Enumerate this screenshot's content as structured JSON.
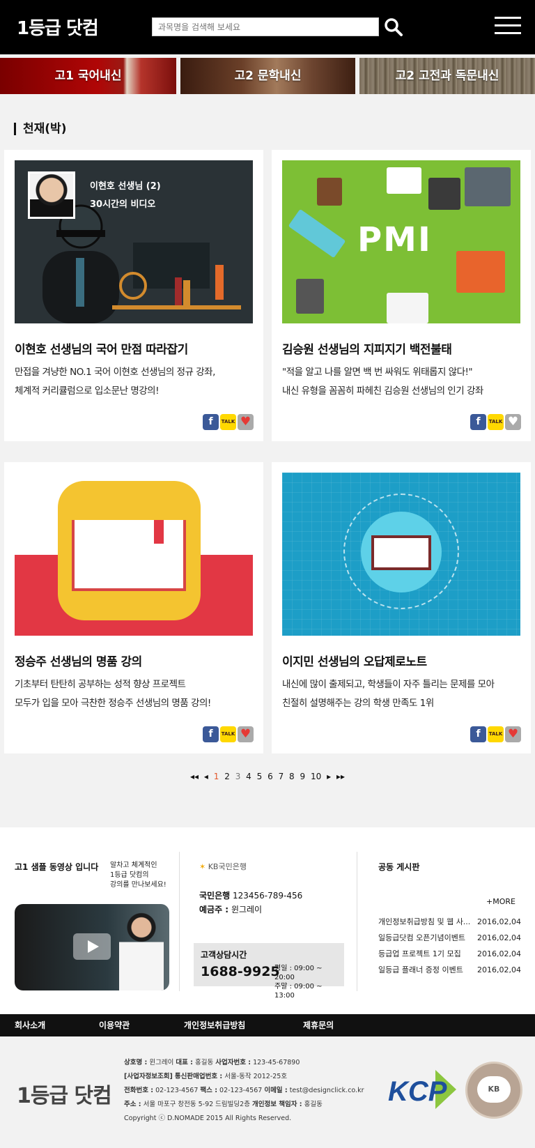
{
  "header": {
    "logo": "1등급 닷컴",
    "search_placeholder": "과목명을 검색해 보세요"
  },
  "banners": [
    {
      "label": "고1 국어내신"
    },
    {
      "label": "고2 문학내신"
    },
    {
      "label": "고2 고전과 독문내신"
    }
  ],
  "section": {
    "title": "천재(박)"
  },
  "cards": [
    {
      "title": "이현호 선생님의 국어 만점 따라잡기",
      "desc_line1": "만접을 겨냥한 NO.1 국어 이현호 선생님의 정규 강좌,",
      "desc_line2": "체계적 커리큘럼으로 입소문난 명강의!",
      "thumb_name": "이현호 선생님 (2)",
      "thumb_video": "30시간의 비디오"
    },
    {
      "title": "김승원 선생님의 지피지기 백전불태",
      "desc_line1": "\"적을 알고 나를 알면 백 번 싸워도 위태롭지 않다!\"",
      "desc_line2": "내신 유형을 꼼꼼히 파헤친 김승원 선생님의 인기 강좌",
      "thumb_text": "PMI"
    },
    {
      "title": "정승주 선생님의 명품 강의",
      "desc_line1": "기초부터 탄탄히 공부하는 성적 향상 프로젝트",
      "desc_line2": "모두가 입을 모아 극찬한 정승주 선생님의 명품 강의!"
    },
    {
      "title": "이지민 선생님의 오답제로노트",
      "desc_line1": "내신에 많이 출제되고, 학생들이 자주 틀리는 문제를 모아",
      "desc_line2": "친절히 설명해주는 강의 학생 만족도 1위"
    }
  ],
  "share": {
    "facebook": "f",
    "kakaotalk": "TALK",
    "like": "♥"
  },
  "pagination": {
    "first": "◂◂",
    "prev": "◂",
    "next": "▸",
    "last": "▸▸",
    "pages": [
      "1",
      "2",
      "3",
      "4",
      "5",
      "6",
      "7",
      "8",
      "9",
      "10"
    ],
    "current": "1"
  },
  "footer_info": {
    "sample_title": "고1 샘플 동영상 입니다",
    "sample_sub": "알차고 체계적인\n1등급 닷컴의\n강의를 만나보세요!",
    "bank": "KB국민은행",
    "account_label": "국민은행",
    "account_number": "123456-789-456",
    "depositor_label": "예금주 :",
    "depositor": "윈그레이",
    "cs_title": "고객상담시간",
    "cs_phone": "1688-9925",
    "cs_hours": "평일 : 09:00 ~ 20:00\n주말 : 09:00 ~ 13:00",
    "board_title": "공동 게시판",
    "more": "+MORE",
    "notices": [
      {
        "title": "개인정보취급방침 및 웹 사...",
        "date": "2016,02,04"
      },
      {
        "title": "일등급닷컴 오픈기념이벤트",
        "date": "2016,02,04"
      },
      {
        "title": "등급업 프로젝트 1기 모집",
        "date": "2016,02,04"
      },
      {
        "title": "일등급 플래너 증정 이벤트",
        "date": "2016,02,04"
      }
    ]
  },
  "footer_nav": [
    "회사소개",
    "이용약관",
    "개인정보취급방침",
    "제휴문의"
  ],
  "company": {
    "logo": "1등급 닷컴",
    "line1_a": "상호명 :",
    "line1_b": "윈그레이",
    "line1_c": "대표 :",
    "line1_d": "홍길동",
    "line1_e": "사업자번호 :",
    "line1_f": "123-45-67890",
    "line2_a": "[사업자정보조회]",
    "line2_b": "통신판매업번호 :",
    "line2_c": "서울-동작 2012-25호",
    "line3_a": "전화번호 :",
    "line3_b": "02-123-4567",
    "line3_c": "팩스 :",
    "line3_d": "02-123-4567",
    "line3_e": "이메일 :",
    "line3_f": "test@designclick.co.kr",
    "line4_a": "주소 :",
    "line4_b": "서울 마포구 창전동 5-92 드림빌딩2층",
    "line4_c": "개인정보 책임자 :",
    "line4_d": "홍길동",
    "line5": "Copyright ⓒ D.NOMADE 2015 All Rights Reserved.",
    "kcp": "KCP",
    "seal": "KB"
  }
}
